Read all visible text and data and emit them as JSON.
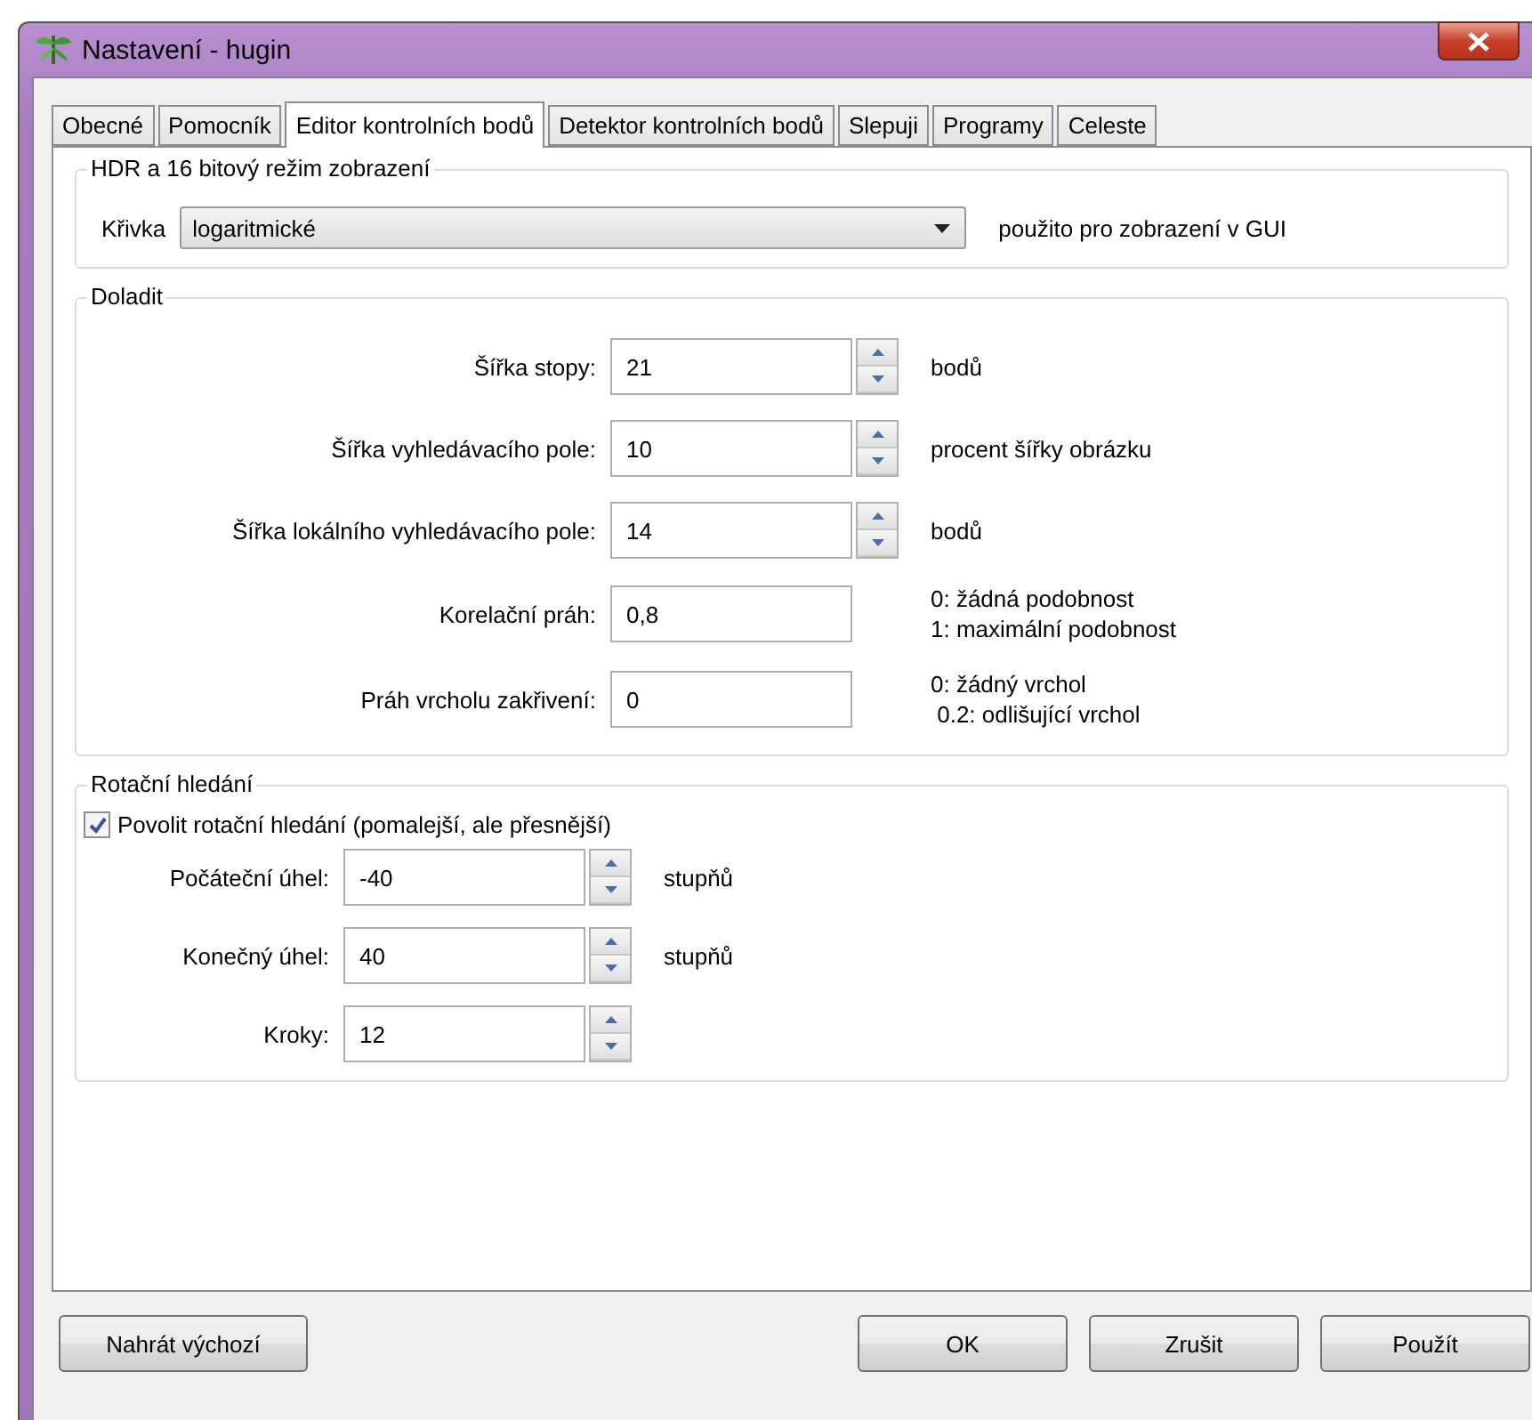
{
  "window": {
    "title": "Nastavení - hugin"
  },
  "tabs": [
    {
      "label": "Obecné",
      "selected": false
    },
    {
      "label": "Pomocník",
      "selected": false
    },
    {
      "label": "Editor kontrolních bodů",
      "selected": true
    },
    {
      "label": "Detektor kontrolních bodů",
      "selected": false
    },
    {
      "label": "Slepuji",
      "selected": false
    },
    {
      "label": "Programy",
      "selected": false
    },
    {
      "label": "Celeste",
      "selected": false
    }
  ],
  "hdr_group": {
    "title": "HDR a 16 bitový režim zobrazení",
    "label": "Křivka",
    "value": "logaritmické",
    "note": "použito pro zobrazení v GUI"
  },
  "fine_tune": {
    "title": "Doladit",
    "rows": [
      {
        "kind": "spin",
        "label": "Šířka stopy:",
        "value": "21",
        "notes": [
          "bodů"
        ]
      },
      {
        "kind": "spin",
        "label": "Šířka vyhledávacího pole:",
        "value": "10",
        "notes": [
          "procent šířky obrázku"
        ]
      },
      {
        "kind": "spin",
        "label": "Šířka lokálního vyhledávacího pole:",
        "value": "14",
        "notes": [
          "bodů"
        ]
      },
      {
        "kind": "text",
        "label": "Korelační práh:",
        "value": "0,8",
        "notes": [
          "0: žádná podobnost",
          "1: maximální podobnost"
        ]
      },
      {
        "kind": "text",
        "label": "Práh vrcholu zakřivení:",
        "value": "0",
        "notes": [
          "0: žádný vrchol",
          " 0.2: odlišující vrchol"
        ]
      }
    ]
  },
  "rotation": {
    "title": "Rotační hledání",
    "checkbox": {
      "label": "Povolit rotační hledání (pomalejší, ale přesnější)",
      "checked": true
    },
    "rows": [
      {
        "label": "Počáteční úhel:",
        "value": "-40",
        "unit": "stupňů"
      },
      {
        "label": "Konečný úhel:",
        "value": "40",
        "unit": "stupňů"
      },
      {
        "label": "Kroky:",
        "value": "12"
      }
    ]
  },
  "buttons": {
    "left": "Nahrát výchozí",
    "right": [
      "OK",
      "Zrušit",
      "Použít"
    ]
  }
}
